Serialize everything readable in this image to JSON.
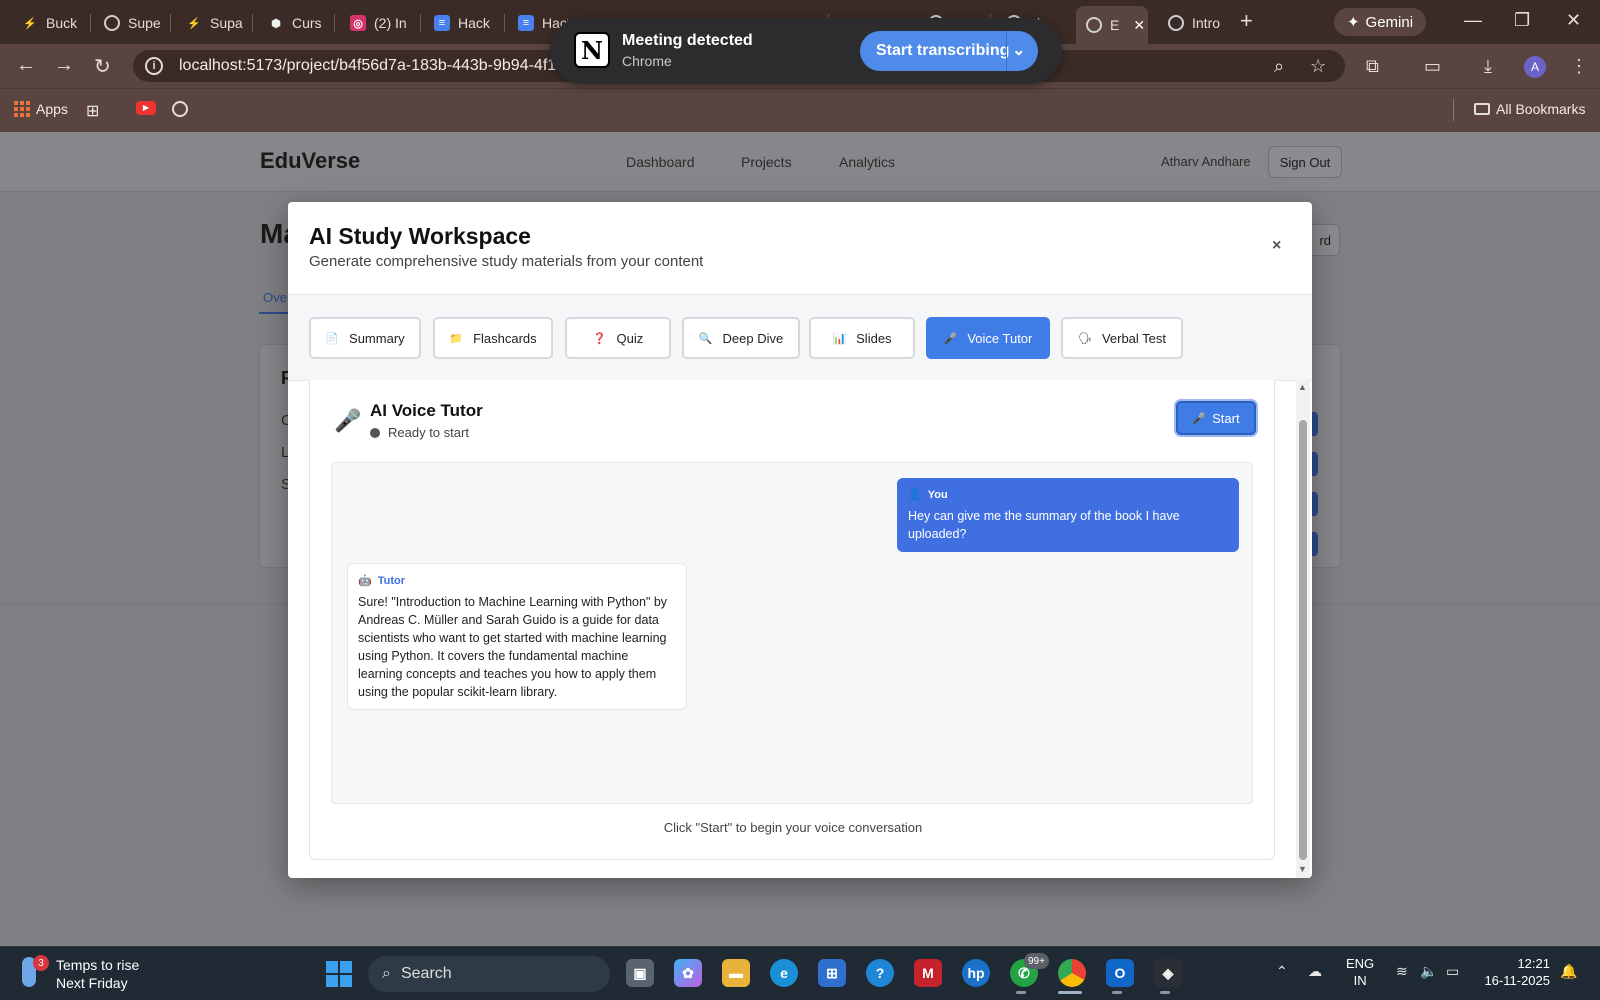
{
  "browser": {
    "tabs": [
      {
        "label": "Buck",
        "icon": "supabase-icon",
        "color": "#3ecf8e"
      },
      {
        "label": "Supe",
        "icon": "openai-icon",
        "color": "#cfcfcf"
      },
      {
        "label": "Supa",
        "icon": "supabase-icon",
        "color": "#3ecf8e"
      },
      {
        "label": "Curs",
        "icon": "cursor-icon",
        "color": "#e6e6e6"
      },
      {
        "label": "(2) In",
        "icon": "instagram-icon",
        "color": "#d6336c"
      },
      {
        "label": "Hack",
        "icon": "google-docs-icon",
        "color": "#4a7ff0"
      },
      {
        "label": "Hack",
        "icon": "google-docs-icon",
        "color": "#4a7ff0"
      },
      {
        "label": "",
        "icon": "globe-icon",
        "color": "#7b9ad6"
      },
      {
        "label": "",
        "icon": "globe-icon",
        "color": "#7b9ad6"
      },
      {
        "label": "",
        "icon": "globe-icon",
        "color": "#7b9ad6"
      },
      {
        "label": "",
        "icon": "globe-icon",
        "color": "#7b9ad6"
      },
      {
        "label": "",
        "icon": "globe-icon",
        "color": "#cfcfcf"
      },
      {
        "label": "u\\",
        "icon": "globe-icon",
        "color": "#cfcfcf"
      },
      {
        "label": "E",
        "icon": "globe-icon",
        "color": "#cfcfcf"
      },
      {
        "label": "Intro",
        "icon": "globe-icon",
        "color": "#cfcfcf"
      }
    ],
    "gemini_label": "Gemini",
    "url": "localhost:5173/project/b4f56d7a-183b-443b-9b94-4f1d",
    "bookmarks": {
      "apps": "Apps",
      "all": "All Bookmarks"
    },
    "profile_initial": "A"
  },
  "notification": {
    "title": "Meeting detected",
    "subtitle": "Chrome",
    "action": "Start transcribing",
    "logo_letter": "N"
  },
  "app": {
    "brand": "EduVerse",
    "nav": [
      "Dashboard",
      "Projects",
      "Analytics"
    ],
    "user": "Atharv Andhare",
    "sign_out": "Sign Out",
    "bg_title_fragment": "Ma",
    "bg_button_fragment": "rd",
    "bg_tab_fragment": "Ove",
    "bg_card_title_fragment": "P",
    "bg_card_rows": [
      "C",
      "L",
      "S"
    ]
  },
  "modal": {
    "title": "AI Study Workspace",
    "subtitle": "Generate comprehensive study materials from your content",
    "close": "×",
    "tabs": [
      {
        "label": "Summary",
        "icon": "📄",
        "active": false
      },
      {
        "label": "Flashcards",
        "icon": "📁",
        "active": false
      },
      {
        "label": "Quiz",
        "icon": "❓",
        "active": false
      },
      {
        "label": "Deep Dive",
        "icon": "🔍",
        "active": false
      },
      {
        "label": "Slides",
        "icon": "📊",
        "active": false
      },
      {
        "label": "Voice Tutor",
        "icon": "🎤",
        "active": true
      },
      {
        "label": "Verbal Test",
        "icon": "🗣",
        "active": false
      }
    ],
    "voice_tutor": {
      "title": "AI Voice Tutor",
      "status": "Ready to start",
      "start_label": "Start",
      "messages": {
        "user_name": "You",
        "user_text": "Hey can give me the summary of the book I have uploaded?",
        "tutor_name": "Tutor",
        "tutor_text": "Sure! \"Introduction to Machine Learning with Python\" by Andreas C. Müller and Sarah Guido is a guide for data scientists who want to get started with machine learning using Python. It covers the fundamental machine learning concepts and teaches you how to apply them using the popular scikit-learn library."
      },
      "hint": "Click \"Start\" to begin your voice conversation"
    }
  },
  "taskbar": {
    "weather_badge": "3",
    "weather_line1": "Temps to rise",
    "weather_line2": "Next Friday",
    "search": "Search",
    "whatsapp_badge": "99+",
    "lang_line1": "ENG",
    "lang_line2": "IN",
    "time": "12:21",
    "date": "16-11-2025"
  },
  "colors": {
    "accent": "#3f7ce6",
    "user_bubble": "#3f6fe0",
    "chrome_frame": "#3b2b27"
  }
}
